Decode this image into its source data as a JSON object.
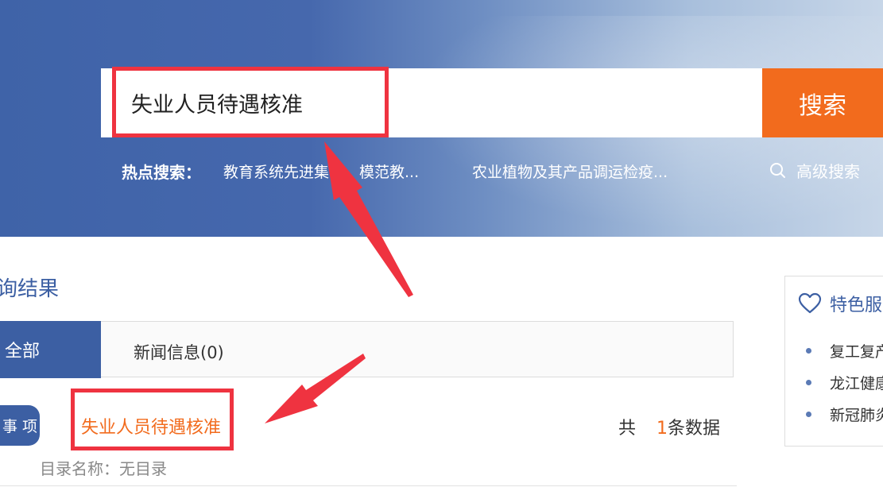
{
  "search": {
    "value": "失业人员待遇核准",
    "button_label": "搜索"
  },
  "hot_search": {
    "label": "热点搜索：",
    "items": [
      "教育系统先进集体、模范教...",
      "农业植物及其产品调运检疫..."
    ]
  },
  "advanced_search": {
    "label": "高级搜索",
    "icon": "search-icon"
  },
  "results": {
    "title": "询结果",
    "tabs": [
      {
        "label": "全部",
        "active": true
      },
      {
        "label": "新闻信息(0)",
        "active": false
      }
    ],
    "item": {
      "badge": "事 项",
      "title": "失业人员待遇核准",
      "catalog": "目录名称：无目录"
    },
    "count_prefix": "共",
    "count": "1",
    "count_suffix": "条数据"
  },
  "sidebar": {
    "title": "特色服",
    "icon": "heart-icon",
    "items": [
      "复工复产",
      "龙江健康",
      "新冠肺炎"
    ]
  },
  "colors": {
    "accent": "#f26b1d",
    "primary": "#3c5fa3",
    "highlight": "#ef3340"
  }
}
